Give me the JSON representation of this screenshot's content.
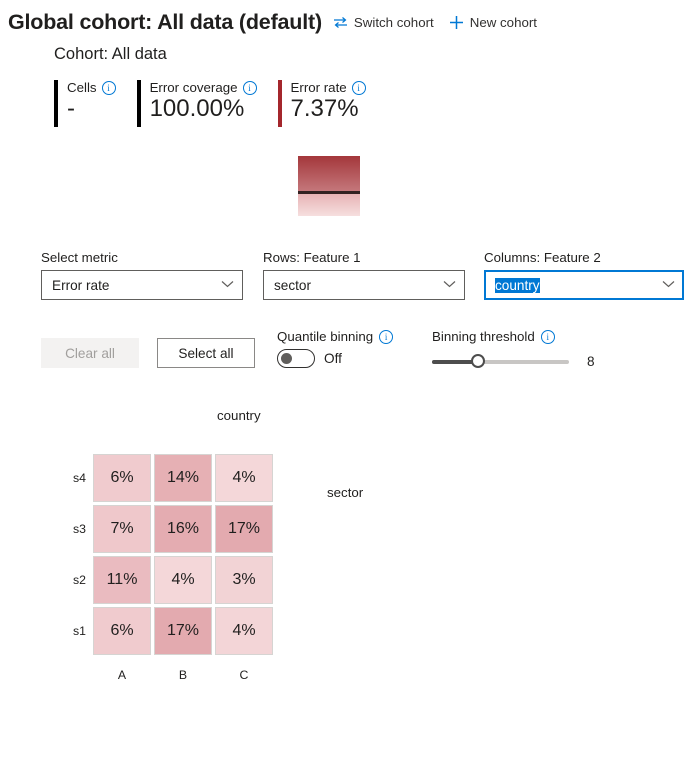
{
  "header": {
    "title": "Global cohort: All data (default)",
    "switch_cohort_label": "Switch cohort",
    "new_cohort_label": "New cohort",
    "cohort_subtitle": "Cohort: All data"
  },
  "stats": [
    {
      "label": "Cells",
      "value": "-",
      "bar_color": "#000000"
    },
    {
      "label": "Error coverage",
      "value": "100.00%",
      "bar_color": "#000000"
    },
    {
      "label": "Error rate",
      "value": "7.37%",
      "bar_color": "#a4262c"
    }
  ],
  "legend": {
    "gradient_top": "#a4373b",
    "gradient_mid": "#c4777b",
    "divider": "#332222",
    "gradient_light_top": "#e7b3b5",
    "gradient_bottom": "#f6dfdf"
  },
  "controls": {
    "metric": {
      "label": "Select metric",
      "value": "Error rate"
    },
    "rows": {
      "label": "Rows: Feature 1",
      "value": "sector"
    },
    "columns": {
      "label": "Columns: Feature 2",
      "value": "country",
      "focused": true,
      "selection_color": "#0078d4"
    }
  },
  "toolbar": {
    "clear_all_label": "Clear all",
    "select_all_label": "Select all",
    "quantile_binning_label": "Quantile binning",
    "quantile_binning_state": "Off",
    "binning_threshold_label": "Binning threshold",
    "binning_threshold_value": "8"
  },
  "chart_data": {
    "type": "heatmap",
    "title": "",
    "xlabel": "country",
    "ylabel": "sector",
    "columns": [
      "A",
      "B",
      "C"
    ],
    "rows": [
      "s4",
      "s3",
      "s2",
      "s1"
    ],
    "unit": "%",
    "values": [
      [
        6,
        14,
        4
      ],
      [
        7,
        16,
        17
      ],
      [
        11,
        4,
        3
      ],
      [
        6,
        17,
        4
      ]
    ],
    "cells": [
      [
        {
          "text": "6%",
          "color": "#f0cbce"
        },
        {
          "text": "14%",
          "color": "#e6b0b4"
        },
        {
          "text": "4%",
          "color": "#f4d7d9"
        }
      ],
      [
        {
          "text": "7%",
          "color": "#efc8cb"
        },
        {
          "text": "16%",
          "color": "#e4acb1"
        },
        {
          "text": "17%",
          "color": "#e3aaaf"
        }
      ],
      [
        {
          "text": "11%",
          "color": "#eabbc0"
        },
        {
          "text": "4%",
          "color": "#f4d7d9"
        },
        {
          "text": "3%",
          "color": "#f2d3d5"
        }
      ],
      [
        {
          "text": "6%",
          "color": "#f0cbce"
        },
        {
          "text": "17%",
          "color": "#e3aaaf"
        },
        {
          "text": "4%",
          "color": "#f3d5d7"
        }
      ]
    ],
    "zmin": 3,
    "zmax": 17,
    "grid": false,
    "legend": "gradient-vertical"
  },
  "icons": {
    "info": "ⓘ",
    "chevron_down": "⌄",
    "switch": "switch-icon",
    "plus": "plus-icon"
  }
}
